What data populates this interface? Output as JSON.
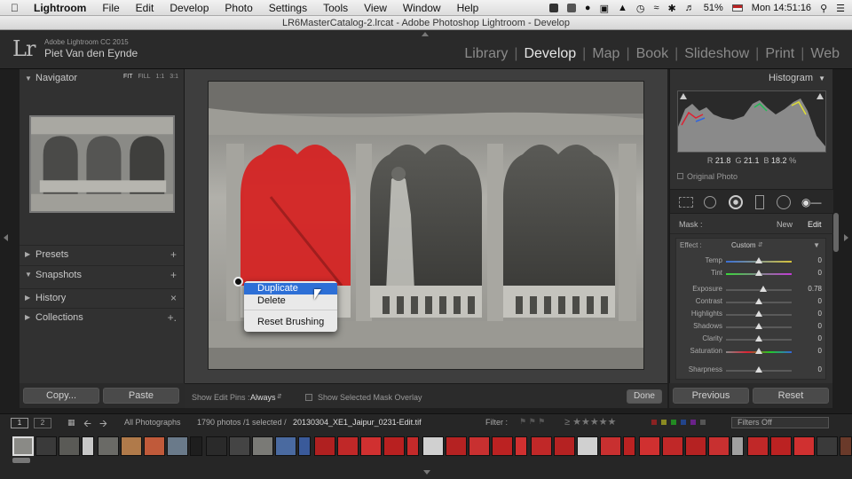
{
  "menubar": {
    "app_name": "Lightroom",
    "menus": [
      "File",
      "Edit",
      "Develop",
      "Photo",
      "Settings",
      "Tools",
      "View",
      "Window",
      "Help"
    ],
    "battery": "51%",
    "clock": "Mon 14:51:16"
  },
  "window": {
    "title": "LR6MasterCatalog-2.lrcat - Adobe Photoshop Lightroom - Develop"
  },
  "identity": {
    "logo": "Lr",
    "product": "Adobe Lightroom CC 2015",
    "user": "Piet Van den Eynde"
  },
  "modules": {
    "items": [
      "Library",
      "Develop",
      "Map",
      "Book",
      "Slideshow",
      "Print",
      "Web"
    ],
    "active": "Develop"
  },
  "left_panel": {
    "navigator": {
      "title": "Navigator",
      "options": [
        "FIT",
        "FILL",
        "1:1",
        "3:1"
      ]
    },
    "sections": [
      {
        "title": "Presets",
        "action": "+"
      },
      {
        "title": "Snapshots",
        "action": "+"
      },
      {
        "title": "History",
        "action": "×"
      },
      {
        "title": "Collections",
        "action": "+."
      }
    ],
    "copy_button": "Copy...",
    "paste_button": "Paste"
  },
  "context_menu": {
    "items": [
      "Duplicate",
      "Delete",
      "Reset Brushing"
    ],
    "highlighted": "Duplicate"
  },
  "toolbar": {
    "edit_pins_label": "Show Edit Pins :",
    "edit_pins_value": "Always",
    "overlay_label": "Show Selected Mask Overlay",
    "done_button": "Done"
  },
  "right_panel": {
    "histogram_title": "Histogram",
    "r_label": "R",
    "r_value": "21.8",
    "g_label": "G",
    "g_value": "21.1",
    "b_label": "B",
    "b_value": "18.2",
    "pct": "%",
    "original_photo": "Original Photo",
    "mask_label": "Mask :",
    "mask_new": "New",
    "mask_edit": "Edit",
    "effect_label": "Effect :",
    "effect_value": "Custom",
    "sliders": [
      {
        "name": "Temp",
        "value": "0",
        "pos": 0.5
      },
      {
        "name": "Tint",
        "value": "0",
        "pos": 0.5
      },
      {
        "name": "Exposure",
        "value": "0.78",
        "pos": 0.57
      },
      {
        "name": "Contrast",
        "value": "0",
        "pos": 0.5
      },
      {
        "name": "Highlights",
        "value": "0",
        "pos": 0.5
      },
      {
        "name": "Shadows",
        "value": "0",
        "pos": 0.5
      },
      {
        "name": "Clarity",
        "value": "0",
        "pos": 0.5
      },
      {
        "name": "Saturation",
        "value": "0",
        "pos": 0.5
      },
      {
        "name": "Sharpness",
        "value": "0",
        "pos": 0.5
      }
    ],
    "previous_button": "Previous",
    "reset_button": "Reset"
  },
  "filmstrip_bar": {
    "page1": "1",
    "page2": "2",
    "source": "All Photographs",
    "count": "1790 photos /1 selected /",
    "filename": "20130304_XE1_Jaipur_0231-Edit.tif",
    "filter_label": "Filter :",
    "filters_off": "Filters Off"
  },
  "colors": {
    "accent": "#2d6fd6",
    "mask_red": "#d62020",
    "panel": "#313131"
  }
}
